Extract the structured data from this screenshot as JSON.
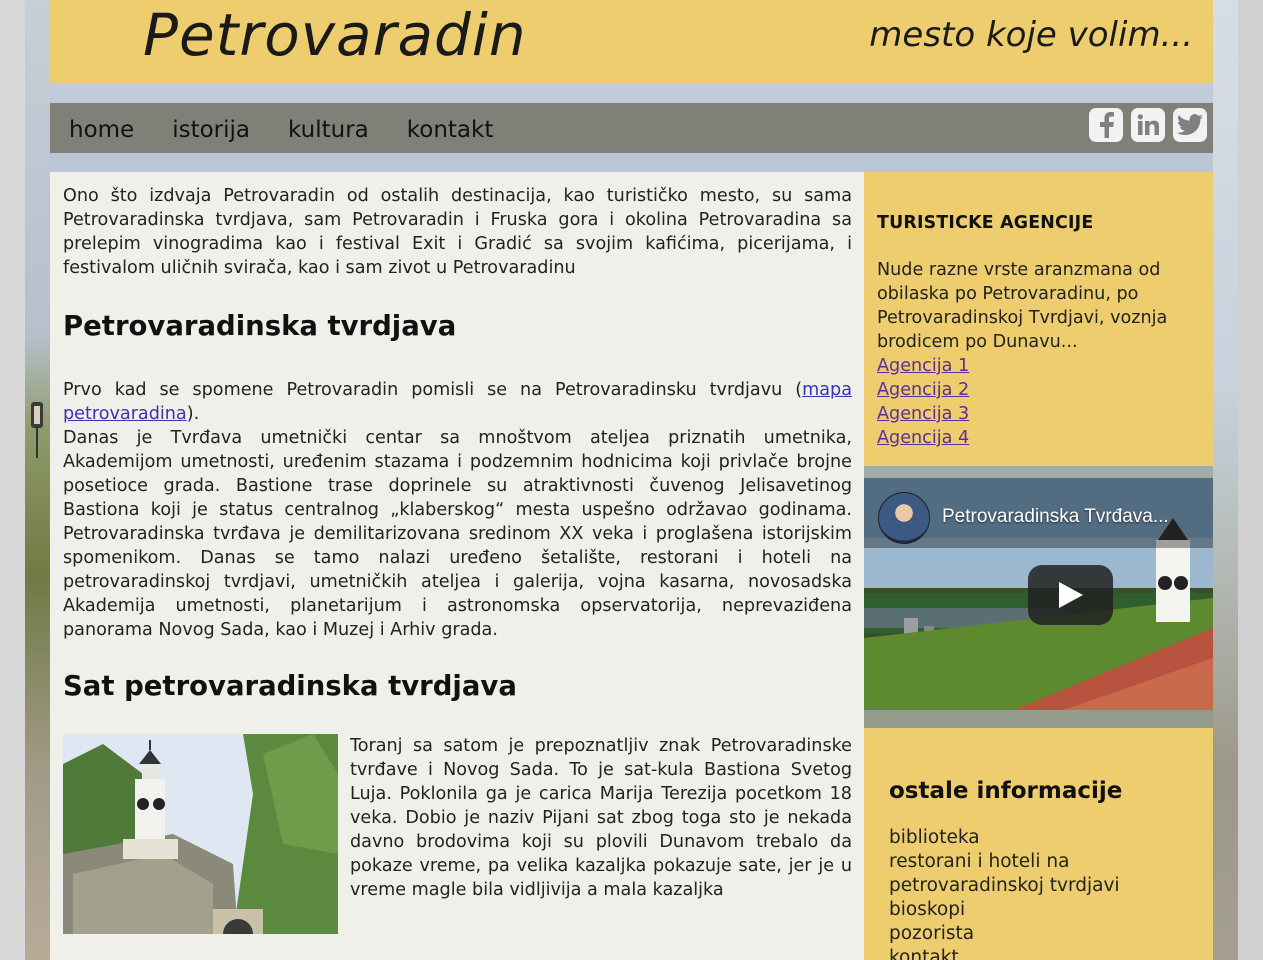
{
  "header": {
    "title": "Petrovaradin",
    "tagline": "mesto koje volim..."
  },
  "nav": {
    "items": [
      "home",
      "istorija",
      "kultura",
      "kontakt"
    ],
    "social": [
      "facebook-icon",
      "linkedin-icon",
      "twitter-icon"
    ]
  },
  "main": {
    "intro": "Ono što izdvaja Petrovaradin od ostalih destinacija, kao turističko mesto, su sama Petrovaradinska tvrdjava, sam Petrovaradin i Fruska gora i okolina Petrovaradina sa prelepim vinogradima kao i festival Exit i Gradić sa svojim kafićima, picerijama, i festivalom uličnih svirača, kao i sam zivot u Petrovaradinu",
    "section1_heading": "Petrovaradinska tvrdjava",
    "para1_before": "Prvo kad se spomene Petrovaradin pomisli se na Petrovaradinsku tvrdjavu (",
    "para1_link": "mapa petrovaradina",
    "para1_after": ").",
    "para2": "Danas je Tvrđava umetnički centar sa mnoštvom ateljea priznatih umetnika, Akademijom umetnosti, uređenim stazama i podzemnim hodnicima koji privlače brojne posetioce grada. Bastione trase doprinele su atraktivnosti čuvenog Jelisavetinog Bastiona koji je status centralnog „klaberskog“ mesta uspešno održavao godinama. Petrovaradinska tvrđava je demilitarizovana sredinom XX veka i proglašena istorijskim spomenikom. Danas se tamo nalazi uređeno šetalište, restorani i hoteli na petrovaradinskoj tvrdjavi, umetničkih ateljea i galerija, vojna kasarna, novosadska Akademija umetnosti, planetarijum i astronomska opservatorija, neprevaziđena panorama Novog Sada, kao i Muzej i Arhiv grada.",
    "section2_heading": "Sat petrovaradinska tvrdjava",
    "para3": "Toranj sa satom je prepoznatljiv znak Petrovaradinske tvrđave i Novog Sada. To je sat-kula Bastiona Svetog Luja. Poklonila ga je carica Marija Terezija pocetkom 18 veka. Dobio je naziv Pijani sat zbog toga sto je nekada davno brodovima koji su plovili Dunavom trebalo da pokaze vreme, pa velika kazaljka pokazuje sate, jer je u vreme magle bila vidljivija a mala kazaljka"
  },
  "agencies": {
    "heading": "TURISTICKE AGENCIJE",
    "text": "Nude razne vrste aranzmana od obilaska po Petrovaradinu, po Petrovaradinskoj Tvrdjavi, voznja brodicem po Dunavu...",
    "links": [
      "Agencija 1",
      "Agencija 2",
      "Agencija 3",
      "Agencija 4"
    ]
  },
  "video": {
    "title": "Petrovaradinska Tvrđava..."
  },
  "info": {
    "heading": "ostale informacije",
    "items": [
      "biblioteka",
      "restorani i hoteli na petrovaradinskoj tvrdjavi",
      "bioskopi",
      "pozorista",
      "kontakt"
    ]
  },
  "colors": {
    "header_bg": "#eecd6e",
    "nav_bg": "#807f78",
    "content_bg": "#f0f0ea",
    "link": "#3a32b0",
    "agency_link": "#5a2f92"
  }
}
